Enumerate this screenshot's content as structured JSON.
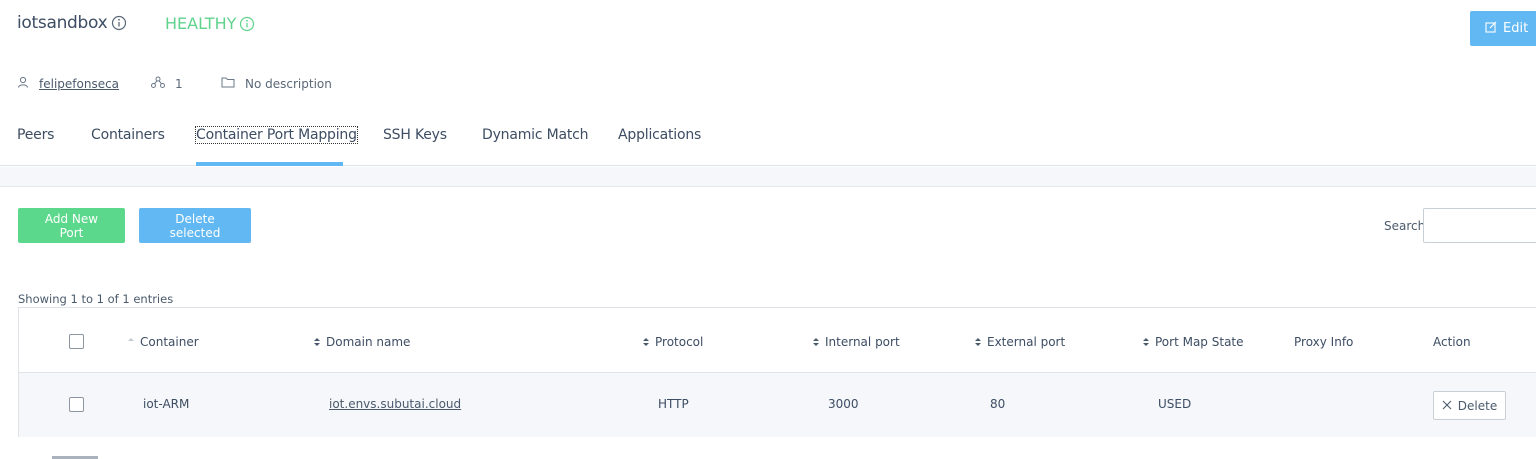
{
  "header": {
    "title": "iotsandbox",
    "status": "HEALTHY",
    "edit_label": "Edit"
  },
  "meta": {
    "owner": "felipefonseca",
    "peer_count": "1",
    "description": "No description"
  },
  "tabs": [
    {
      "label": "Peers"
    },
    {
      "label": "Containers"
    },
    {
      "label": "Container Port Mapping"
    },
    {
      "label": "SSH Keys"
    },
    {
      "label": "Dynamic Match"
    },
    {
      "label": "Applications"
    }
  ],
  "toolbar": {
    "add_label": "Add New Port",
    "delete_selected_label": "Delete selected",
    "search_label": "Search:",
    "search_value": ""
  },
  "table": {
    "info": "Showing 1 to 1 of 1 entries",
    "columns": [
      "Container",
      "Domain name",
      "Protocol",
      "Internal port",
      "External port",
      "Port Map State",
      "Proxy Info",
      "Action"
    ],
    "rows": [
      {
        "container": "iot-ARM",
        "domain": "iot.envs.subutai.cloud",
        "protocol": "HTTP",
        "internal_port": "3000",
        "external_port": "80",
        "state": "USED",
        "proxy_info": "",
        "action_label": "Delete"
      }
    ]
  },
  "colors": {
    "accent": "#62b8f3",
    "success": "#5cd88c",
    "healthy": "#5fd38c"
  },
  "icons": [
    "info-icon",
    "user-icon",
    "peers-icon",
    "folder-icon",
    "edit-icon",
    "sort-icon",
    "close-icon"
  ]
}
